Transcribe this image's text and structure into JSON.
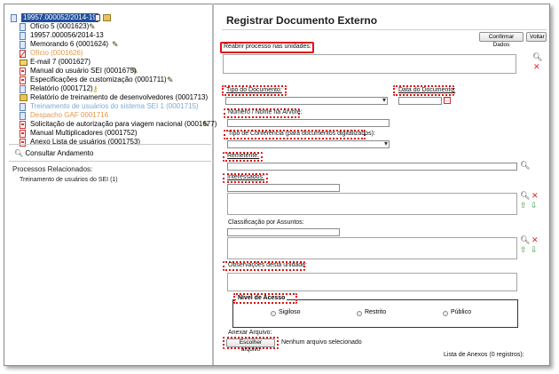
{
  "tree": {
    "process": "19957.000052/2014-19",
    "items": [
      {
        "label": "Ofício 5 (0001623)",
        "icon": "document-icon"
      },
      {
        "label": "19957.000056/2014-13",
        "icon": "document-icon"
      },
      {
        "label": "Memorando 6 (0001624)",
        "icon": "document-icon"
      },
      {
        "label": "Ofício (0001626)",
        "icon": "cancelled-document-icon",
        "color": "#e6994a"
      },
      {
        "label": "E-mail 7 (0001627)",
        "icon": "email-icon"
      },
      {
        "label": "Manual do usuário SEI (0001675)",
        "icon": "pdf-icon"
      },
      {
        "label": "Especificações de customização (0001711)",
        "icon": "pdf-icon"
      },
      {
        "label": "Relatório (0001712)",
        "icon": "document-icon"
      },
      {
        "label": "Relatório de treinamento de desenvolvedores (0001713)",
        "icon": "folder-icon"
      },
      {
        "label": "Treinamento de usuários do sistema SEI 1 (0001715)",
        "icon": "document-icon",
        "color": "#7aa9d8"
      },
      {
        "label": "Despacho GAF 0001716",
        "icon": "document-icon",
        "color": "#e6994a"
      },
      {
        "label": "Solicitação de autorização para viagem nacional (0001677)",
        "icon": "pdf-icon"
      },
      {
        "label": "Manual Multiplicadores (0001752)",
        "icon": "pdf-icon"
      },
      {
        "label": "Anexo Lista de usuários (0001753)",
        "icon": "pdf-icon"
      }
    ]
  },
  "left": {
    "consultar": "Consultar Andamento",
    "related_title": "Processos Relacionados:",
    "related_item": "Treinamento de usuários do SEI (1)"
  },
  "form": {
    "title": "Registrar Documento Externo",
    "confirm_button": "Confirmar Dados",
    "back_button": "Voltar",
    "reopen_label": "Reabrir processo nas unidades:",
    "doc_type_label": "Tipo do Documento:",
    "doc_date_label": "Data do Documento:",
    "number_label": "Número / Nome na Árvore:",
    "conference_label": "Tipo de Conferência (para documentos digitalizados):",
    "sender_label": "Remetente:",
    "interested_label": "Interessados:",
    "classification_label": "Classificação por Assuntos:",
    "observations_label": "Observações desta unidade:",
    "access_label": "Nível de Acesso",
    "access_options": [
      "Sigiloso",
      "Restrito",
      "Público"
    ],
    "attach_label": "Anexar Arquivo:",
    "choose_file_button": "Escolher arquivo",
    "no_file_text": "Nenhum arquivo selecionado",
    "attachments_text": "Lista de Anexos (0 registros):"
  },
  "colors": {
    "highlight": "#d11111",
    "process_bg": "#1f4e9c"
  }
}
